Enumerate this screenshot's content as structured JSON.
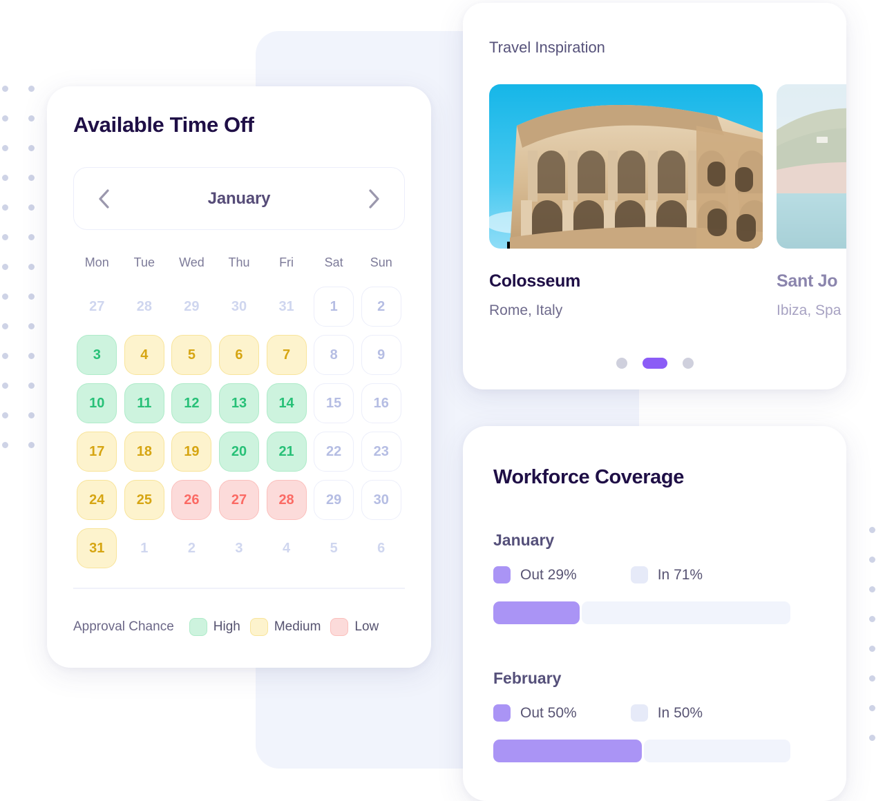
{
  "theme": {
    "accent": "#8b5cf6",
    "bar_out": "#aa94f5",
    "bar_in": "#e6eaf8",
    "high": "#cdf3de",
    "medium": "#fdf3cd",
    "low": "#fcdbda",
    "title_color": "#1f0f46",
    "dot_color": "#ced3e6",
    "ghost_card": "#f1f4fc"
  },
  "calendar": {
    "title": "Available Time Off",
    "month": "January",
    "prev_icon": "chevron-left-icon",
    "next_icon": "chevron-right-icon",
    "weekdays": [
      "Mon",
      "Tue",
      "Wed",
      "Thu",
      "Fri",
      "Sat",
      "Sun"
    ],
    "days": [
      {
        "n": "27",
        "state": "muted"
      },
      {
        "n": "28",
        "state": "muted"
      },
      {
        "n": "29",
        "state": "muted"
      },
      {
        "n": "30",
        "state": "muted"
      },
      {
        "n": "31",
        "state": "muted"
      },
      {
        "n": "1",
        "state": "plain"
      },
      {
        "n": "2",
        "state": "plain"
      },
      {
        "n": "3",
        "state": "high"
      },
      {
        "n": "4",
        "state": "medium"
      },
      {
        "n": "5",
        "state": "medium"
      },
      {
        "n": "6",
        "state": "medium"
      },
      {
        "n": "7",
        "state": "medium"
      },
      {
        "n": "8",
        "state": "plain"
      },
      {
        "n": "9",
        "state": "plain"
      },
      {
        "n": "10",
        "state": "high"
      },
      {
        "n": "11",
        "state": "high"
      },
      {
        "n": "12",
        "state": "high"
      },
      {
        "n": "13",
        "state": "high"
      },
      {
        "n": "14",
        "state": "high"
      },
      {
        "n": "15",
        "state": "plain"
      },
      {
        "n": "16",
        "state": "plain"
      },
      {
        "n": "17",
        "state": "medium"
      },
      {
        "n": "18",
        "state": "medium"
      },
      {
        "n": "19",
        "state": "medium"
      },
      {
        "n": "20",
        "state": "high"
      },
      {
        "n": "21",
        "state": "high"
      },
      {
        "n": "22",
        "state": "plain"
      },
      {
        "n": "23",
        "state": "plain"
      },
      {
        "n": "24",
        "state": "medium"
      },
      {
        "n": "25",
        "state": "medium"
      },
      {
        "n": "26",
        "state": "low"
      },
      {
        "n": "27",
        "state": "low"
      },
      {
        "n": "28",
        "state": "low"
      },
      {
        "n": "29",
        "state": "plain"
      },
      {
        "n": "30",
        "state": "plain"
      },
      {
        "n": "31",
        "state": "medium"
      },
      {
        "n": "1",
        "state": "muted"
      },
      {
        "n": "2",
        "state": "muted"
      },
      {
        "n": "3",
        "state": "muted"
      },
      {
        "n": "4",
        "state": "muted"
      },
      {
        "n": "5",
        "state": "muted"
      },
      {
        "n": "6",
        "state": "muted"
      }
    ],
    "legend": {
      "title": "Approval Chance",
      "items": [
        {
          "label": "High",
          "state": "high"
        },
        {
          "label": "Medium",
          "state": "medium"
        },
        {
          "label": "Low",
          "state": "low"
        }
      ]
    }
  },
  "travel": {
    "heading": "Travel Inspiration",
    "slides": [
      {
        "name": "Colosseum",
        "location": "Rome, Italy",
        "photo": "colosseum-photo"
      },
      {
        "name": "Sant Jo",
        "location": "Ibiza, Spa",
        "photo": "ibiza-coast-photo"
      }
    ],
    "carousel_dots": [
      {
        "active": false
      },
      {
        "active": true
      },
      {
        "active": false
      }
    ]
  },
  "workforce": {
    "title": "Workforce Coverage",
    "blocks": [
      {
        "month": "January",
        "out_label": "Out 29%",
        "in_label": "In 71%",
        "out_pct": 29,
        "in_pct": 71
      },
      {
        "month": "February",
        "out_label": "Out 50%",
        "in_label": "In 50%",
        "out_pct": 50,
        "in_pct": 50
      }
    ]
  }
}
